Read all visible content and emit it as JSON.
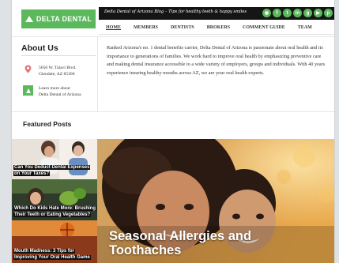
{
  "header": {
    "logo_text": "DELTA DENTAL",
    "tagline": "Delta Dental of Arizona Blog – Tips for healthy teeth & happy smiles",
    "social_icons": [
      "rss-icon",
      "facebook-icon",
      "twitter-icon",
      "linkedin-icon",
      "google-plus-icon",
      "youtube-icon",
      "pinterest-icon"
    ],
    "social_glyphs": [
      "◉",
      "f",
      "t",
      "in",
      "g",
      "▶",
      "p"
    ],
    "brand_color": "#5cb85c"
  },
  "nav": {
    "items": [
      "HOME",
      "MEMBERS",
      "DENTISTS",
      "BROKERS",
      "COMMENT GUIDE",
      "TEAM"
    ],
    "active": "HOME"
  },
  "about": {
    "title": "About Us",
    "address_line1": "5656 W. Talavi Blvd.",
    "address_line2": "Glendale, AZ 85306",
    "learn_line1": "Learn more about",
    "learn_line2": "Delta Dental of Arizona",
    "blurb": "Ranked Arizona's no. 1 dental benefits carrier, Delta Dental of Arizona is passionate about oral health and its importance to generations of families. We work hard to improve oral health by emphasizing preventive care and making dental insurance accessible to a wide variety of employers, groups and individuals. With 40 years experience insuring healthy mouths across AZ, we are your oral health experts."
  },
  "featured": {
    "title": "Featured Posts",
    "posts": [
      "Can You Deduct Dental Expenses on Your Taxes?",
      "Which Do Kids Hate More: Brushing Their Teeth or Eating Vegetables?",
      "Mouth Madness: 3 Tips for Improving Your Oral Health Game"
    ],
    "hero_title_line1": "Seasonal Allergies and",
    "hero_title_line2": "Toothaches"
  }
}
